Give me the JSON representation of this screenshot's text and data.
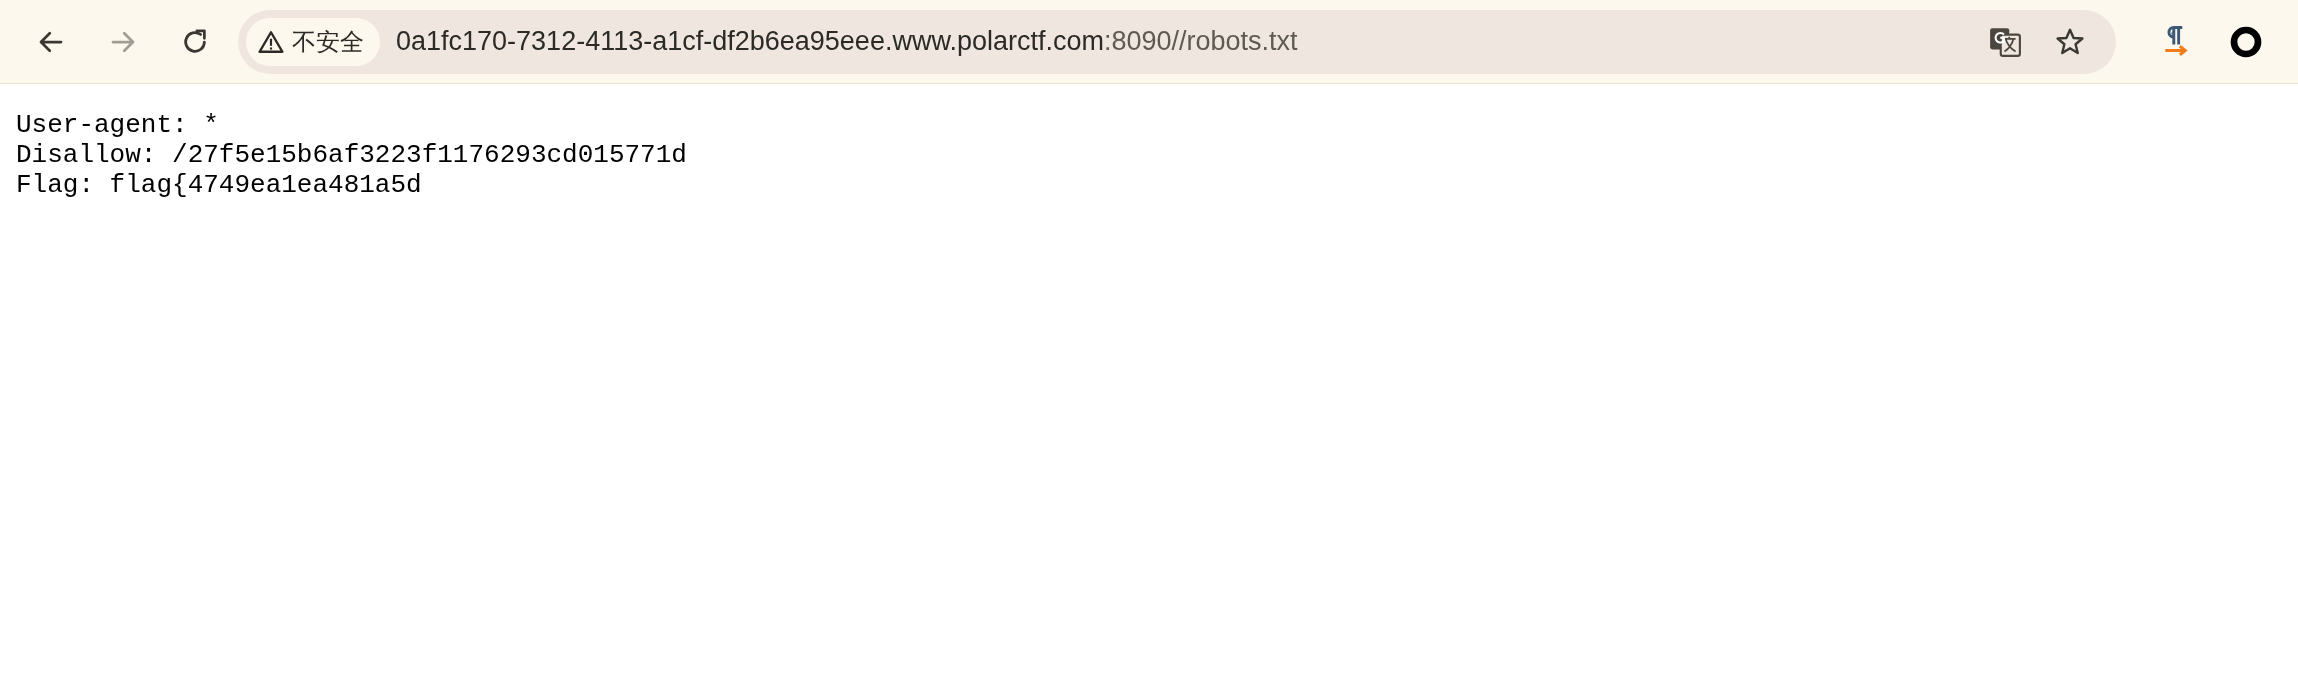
{
  "toolbar": {
    "nav_buttons": [
      {
        "kind": "back",
        "disabled": false
      },
      {
        "kind": "forward",
        "disabled": true
      },
      {
        "kind": "reload",
        "disabled": false
      }
    ],
    "security_chip": {
      "label": "不安全"
    },
    "address": {
      "host": "0a1fc170-7312-4113-a1cf-df2b6ea95eee.www.polarctf.com",
      "rest": ":8090//robots.txt"
    }
  },
  "document": {
    "lines": [
      "User-agent: *",
      "Disallow: /27f5e15b6af3223f1176293cd015771d",
      "Flag: flag{4749ea1ea481a5d"
    ]
  }
}
